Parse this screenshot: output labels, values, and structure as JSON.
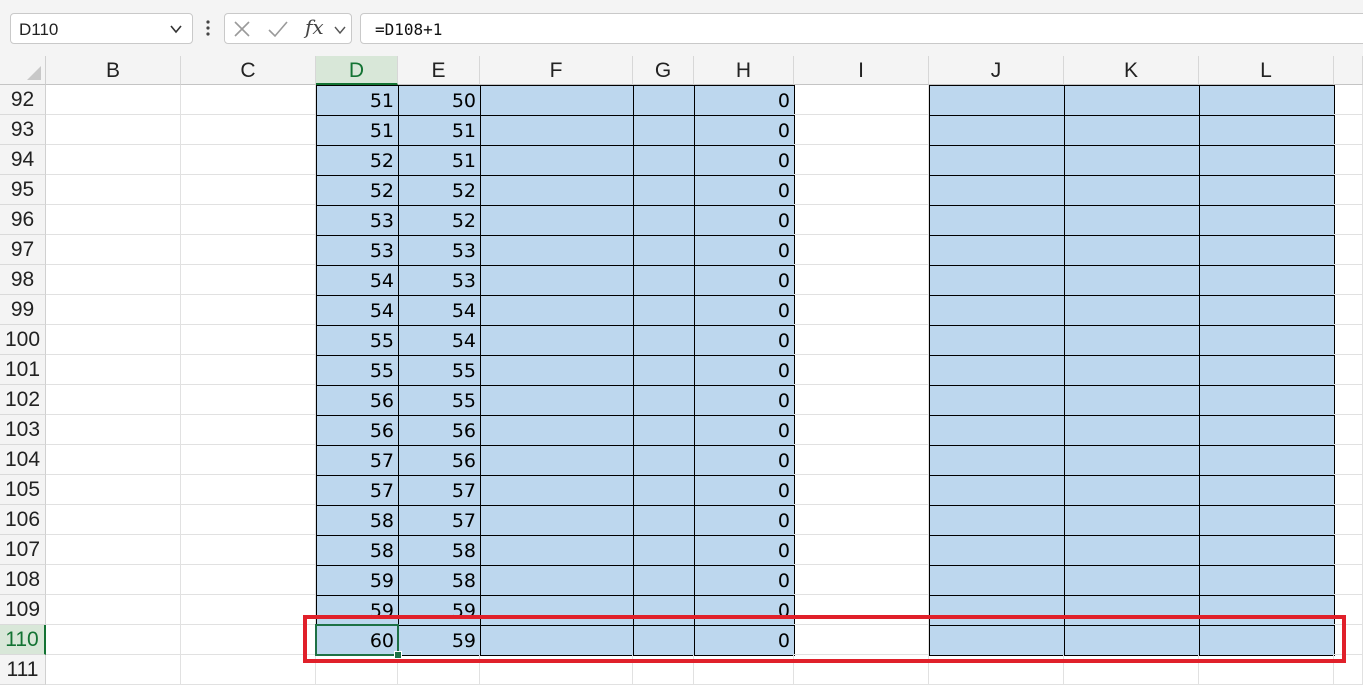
{
  "name_box": {
    "value": "D110"
  },
  "formula_bar": {
    "formula": "=D108+1"
  },
  "columns": [
    "B",
    "C",
    "D",
    "E",
    "F",
    "G",
    "H",
    "I",
    "J",
    "K",
    "L"
  ],
  "selected_column": "D",
  "selected_row": "110",
  "rows": [
    {
      "row": "92",
      "D": "51",
      "E": "50",
      "H": "0"
    },
    {
      "row": "93",
      "D": "51",
      "E": "51",
      "H": "0"
    },
    {
      "row": "94",
      "D": "52",
      "E": "51",
      "H": "0"
    },
    {
      "row": "95",
      "D": "52",
      "E": "52",
      "H": "0"
    },
    {
      "row": "96",
      "D": "53",
      "E": "52",
      "H": "0"
    },
    {
      "row": "97",
      "D": "53",
      "E": "53",
      "H": "0"
    },
    {
      "row": "98",
      "D": "54",
      "E": "53",
      "H": "0"
    },
    {
      "row": "99",
      "D": "54",
      "E": "54",
      "H": "0"
    },
    {
      "row": "100",
      "D": "55",
      "E": "54",
      "H": "0"
    },
    {
      "row": "101",
      "D": "55",
      "E": "55",
      "H": "0"
    },
    {
      "row": "102",
      "D": "56",
      "E": "55",
      "H": "0"
    },
    {
      "row": "103",
      "D": "56",
      "E": "56",
      "H": "0"
    },
    {
      "row": "104",
      "D": "57",
      "E": "56",
      "H": "0"
    },
    {
      "row": "105",
      "D": "57",
      "E": "57",
      "H": "0"
    },
    {
      "row": "106",
      "D": "58",
      "E": "57",
      "H": "0"
    },
    {
      "row": "107",
      "D": "58",
      "E": "58",
      "H": "0"
    },
    {
      "row": "108",
      "D": "59",
      "E": "58",
      "H": "0"
    },
    {
      "row": "109",
      "D": "59",
      "E": "59",
      "H": "0"
    },
    {
      "row": "110",
      "D": "60",
      "E": "59",
      "H": "0"
    },
    {
      "row": "111"
    }
  ],
  "filled_columns": [
    "D",
    "E",
    "F",
    "G",
    "H",
    "J",
    "K",
    "L"
  ],
  "colors": {
    "fill": "#bdd7ee",
    "selection": "#1e7145",
    "highlight_box": "#e0202a"
  },
  "icons": [
    "chevron-down-icon",
    "more-vertical-icon",
    "cancel-icon",
    "enter-check-icon",
    "insert-function-icon"
  ]
}
